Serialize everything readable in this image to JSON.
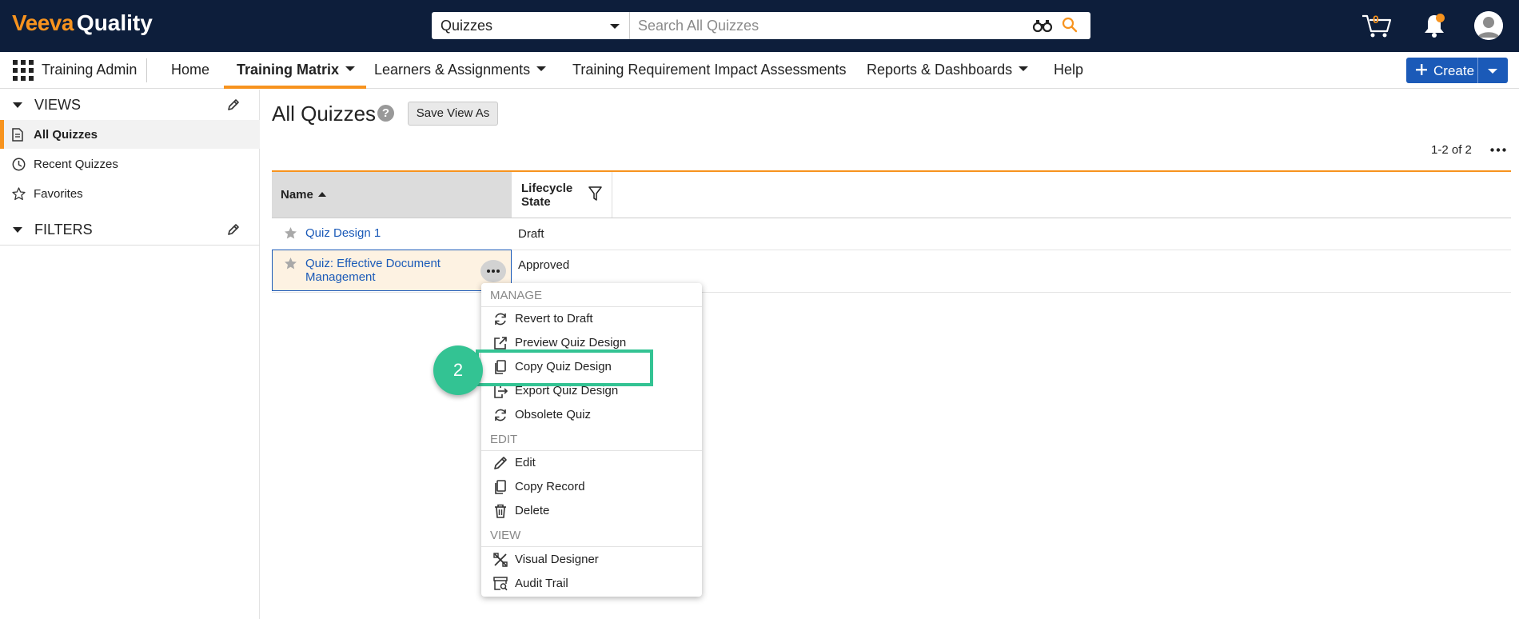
{
  "header": {
    "brand": "Veeva",
    "product": "Quality",
    "search_scope": "Quizzes",
    "search_placeholder": "Search All Quizzes",
    "cart_count": "0"
  },
  "nav": {
    "app_name": "Training Admin",
    "items": [
      {
        "label": "Home",
        "active": false
      },
      {
        "label": "Training Matrix",
        "active": true
      },
      {
        "label": "Learners & Assignments",
        "active": false
      },
      {
        "label": "Training Requirement Impact Assessments",
        "active": false
      },
      {
        "label": "Reports & Dashboards",
        "active": false
      },
      {
        "label": "Help",
        "active": false
      }
    ],
    "create_label": "Create"
  },
  "sidebar": {
    "views_title": "VIEWS",
    "views": [
      {
        "label": "All Quizzes",
        "icon": "document-icon",
        "active": true
      },
      {
        "label": "Recent Quizzes",
        "icon": "clock-icon",
        "active": false
      },
      {
        "label": "Favorites",
        "icon": "star-icon",
        "active": false
      }
    ],
    "filters_title": "FILTERS"
  },
  "main": {
    "title": "All Quizzes",
    "help_glyph": "?",
    "save_view_label": "Save View As",
    "count_text": "1-2 of 2",
    "columns": [
      "Name",
      "Lifecycle State"
    ],
    "rows": [
      {
        "name": "Quiz Design 1",
        "state": "Draft"
      },
      {
        "name": "Quiz: Effective Document Management",
        "state": "Approved"
      }
    ]
  },
  "context_menu": {
    "groups": [
      {
        "title": "MANAGE",
        "items": [
          {
            "label": "Revert to Draft",
            "icon": "refresh-icon"
          },
          {
            "label": "Preview Quiz Design",
            "icon": "external-link-icon"
          },
          {
            "label": "Copy Quiz Design",
            "icon": "copy-icon"
          },
          {
            "label": "Export Quiz Design",
            "icon": "export-icon"
          },
          {
            "label": "Obsolete Quiz",
            "icon": "refresh-icon"
          }
        ]
      },
      {
        "title": "EDIT",
        "items": [
          {
            "label": "Edit",
            "icon": "pencil-icon"
          },
          {
            "label": "Copy Record",
            "icon": "copy-icon"
          },
          {
            "label": "Delete",
            "icon": "trash-icon"
          }
        ]
      },
      {
        "title": "VIEW",
        "items": [
          {
            "label": "Visual Designer",
            "icon": "designer-icon"
          },
          {
            "label": "Audit Trail",
            "icon": "audit-icon"
          }
        ]
      }
    ]
  },
  "callout": {
    "step": "2"
  },
  "colors": {
    "topbar": "#0d1e3b",
    "accent": "#f7931e",
    "link": "#1b5ab8",
    "callout": "#33c393"
  }
}
